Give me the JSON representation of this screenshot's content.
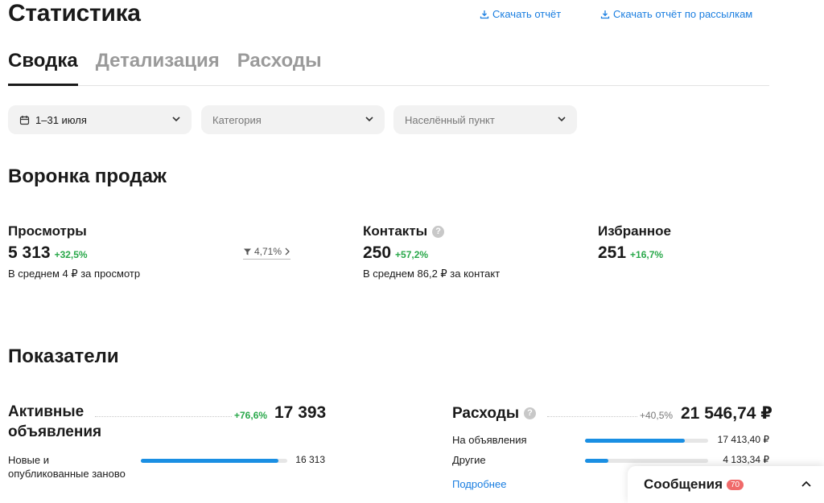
{
  "header": {
    "title": "Статистика",
    "download_report": "Скачать отчёт",
    "download_mailing_report": "Скачать отчёт по рассылкам"
  },
  "tabs": [
    {
      "label": "Сводка",
      "active": true
    },
    {
      "label": "Детализация",
      "active": false
    },
    {
      "label": "Расходы",
      "active": false
    }
  ],
  "filters": {
    "date": "1–31 июля",
    "category_placeholder": "Категория",
    "location_placeholder": "Населённый пункт"
  },
  "funnel": {
    "title": "Воронка продаж",
    "views": {
      "label": "Просмотры",
      "value": "5 313",
      "delta": "+32,5%",
      "sub": "В среднем 4 ₽ за просмотр"
    },
    "conversion": "4,71%",
    "contacts": {
      "label": "Контакты",
      "value": "250",
      "delta": "+57,2%",
      "sub": "В среднем 86,2 ₽ за контакт"
    },
    "favorites": {
      "label": "Избранное",
      "value": "251",
      "delta": "+16,7%"
    }
  },
  "indicators": {
    "title": "Показатели",
    "active_ads": {
      "label": "Активные объявления",
      "delta": "+76,6%",
      "value": "17 393",
      "rows": [
        {
          "label": "Новые и опубликованные заново",
          "value": "16 313",
          "fill": 0.94
        }
      ]
    },
    "expenses": {
      "label": "Расходы",
      "delta": "+40,5%",
      "value": "21 546,74 ₽",
      "rows": [
        {
          "label": "На объявления",
          "value": "17 413,40 ₽",
          "fill": 0.81
        },
        {
          "label": "Другие",
          "value": "4 133,34 ₽",
          "fill": 0.19
        }
      ],
      "more": "Подробнее"
    }
  },
  "messages": {
    "title": "Сообщения",
    "count": "70"
  },
  "colors": {
    "accent": "#1a7ee0",
    "positive": "#29a84a",
    "bar": "#1a8fe3",
    "badge": "#f06a6a"
  }
}
